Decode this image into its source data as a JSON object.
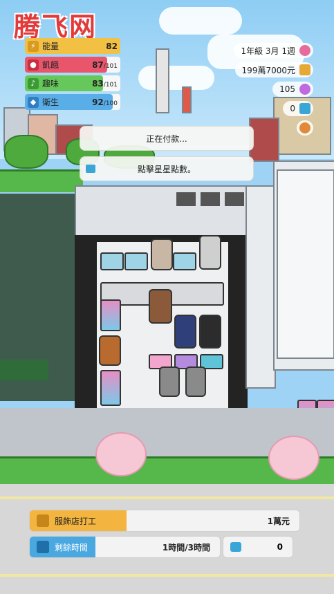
{
  "watermark": {
    "text": "腾飞网"
  },
  "stats": [
    {
      "label": "能量",
      "value": "82",
      "max": "",
      "icon": "energy-icon",
      "color": "#f2c043",
      "fill": 1.0
    },
    {
      "label": "飢餓",
      "value": "87",
      "max": "/101",
      "icon": "apple-icon",
      "color": "#e9566c",
      "fill": 0.86
    },
    {
      "label": "趣味",
      "value": "83",
      "max": "/101",
      "icon": "music-note-icon",
      "color": "#66c85a",
      "fill": 0.82
    },
    {
      "label": "衛生",
      "value": "92",
      "max": "/100",
      "icon": "water-drop-icon",
      "color": "#5aaee8",
      "fill": 0.92
    }
  ],
  "resources": [
    {
      "text": "1年級 3月 1週",
      "icon": "calendar-icon",
      "color": "#e56c9d"
    },
    {
      "text": "199萬7000元",
      "icon": "money-icon",
      "color": "#e7a935"
    },
    {
      "text": "105",
      "icon": "gem-icon",
      "color": "#c06ae0"
    },
    {
      "text": "0",
      "icon": "ticket-icon",
      "color": "#3aa6d8"
    },
    {
      "text": "",
      "icon": "bread-icon",
      "color": "#e08a3a"
    }
  ],
  "toasts": [
    {
      "text": "正在付款..."
    },
    {
      "text": "點擊星星點數。",
      "icon": "star-point-icon"
    }
  ],
  "job": {
    "label": "服飾店打工",
    "value": "1萬元",
    "icon": "job-icon",
    "color": "#f3b53f"
  },
  "time": {
    "label": "剩餘時間",
    "value": "1時間/3時間",
    "icon": "clock-icon",
    "color": "#4aa8e0"
  },
  "tickets": {
    "value": "0",
    "icon": "ticket-icon"
  }
}
